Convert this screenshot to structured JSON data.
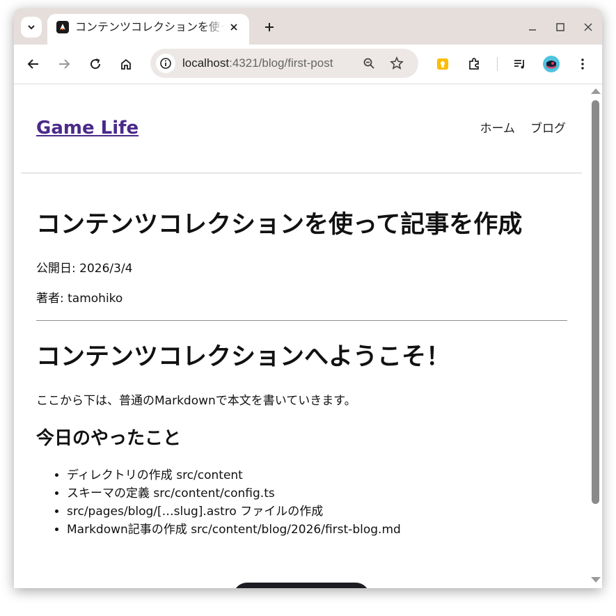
{
  "browser": {
    "tab": {
      "title": "コンテンツコレクションを使って記事を作成",
      "close_icon": "close-icon"
    },
    "url": {
      "host": "localhost",
      "path": ":4321/blog/first-post"
    }
  },
  "site": {
    "title": "Game Life",
    "nav": [
      "ホーム",
      "ブログ"
    ]
  },
  "post": {
    "title": "コンテンツコレクションを使って記事を作成",
    "date": "公開日: 2026/3/4",
    "author": "著者: tamohiko",
    "h1": "コンテンツコレクションへようこそ！",
    "paragraph": "ここから下は、普通のMarkdownで本文を書いていきます。",
    "h2": "今日のやったこと",
    "list": [
      "ディレクトリの作成 src/content",
      "スキーマの定義 src/content/config.ts",
      "src/pages/blog/[…slug].astro ファイルの作成",
      "Markdown記事の作成 src/content/blog/2026/first-blog.md"
    ]
  },
  "colors": {
    "site_title": "#4b2a8a",
    "tabstrip": "#e5dedb",
    "omnibox": "#ede8e6"
  }
}
